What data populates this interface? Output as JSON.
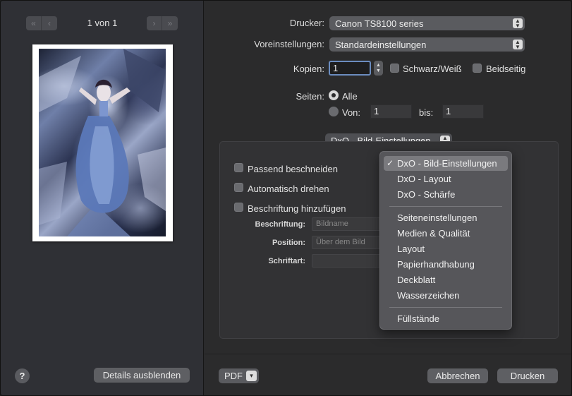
{
  "preview": {
    "page_indicator": "1 von 1",
    "prev_icons": [
      "«",
      "‹"
    ],
    "next_icons": [
      "›",
      "»"
    ]
  },
  "left_footer": {
    "help_label": "?",
    "hide_details_label": "Details ausblenden"
  },
  "printer": {
    "label": "Drucker:",
    "value": "Canon TS8100 series"
  },
  "presets": {
    "label": "Voreinstellungen:",
    "value": "Standardeinstellungen"
  },
  "copies": {
    "label": "Kopien:",
    "value": "1",
    "bw_label": "Schwarz/Weiß",
    "duplex_label": "Beidseitig"
  },
  "pages": {
    "label": "Seiten:",
    "all_label": "Alle",
    "from_label": "Von:",
    "from_value": "1",
    "to_label": "bis:",
    "to_value": "1"
  },
  "panel_selector": {
    "value": "DxO - Bild-Einstellungen"
  },
  "dxo_options": {
    "crop_label": "Passend beschneiden",
    "rotate_label": "Automatisch drehen",
    "caption_label": "Beschriftung hinzufügen",
    "caption_field_label": "Beschriftung:",
    "caption_field_value": "Bildname",
    "position_label": "Position:",
    "position_value": "Über dem Bild",
    "font_label": "Schriftart:",
    "font_value": ""
  },
  "menu": {
    "check_glyph": "✓",
    "group1": [
      "DxO - Bild-Einstellungen",
      "DxO - Layout",
      "DxO - Schärfe"
    ],
    "group2": [
      "Seiteneinstellungen",
      "Medien & Qualität",
      "Layout",
      "Papierhandhabung",
      "Deckblatt",
      "Wasserzeichen"
    ],
    "group3": [
      "Füllstände"
    ]
  },
  "footer": {
    "pdf_label": "PDF",
    "cancel_label": "Abbrechen",
    "print_label": "Drucken"
  }
}
